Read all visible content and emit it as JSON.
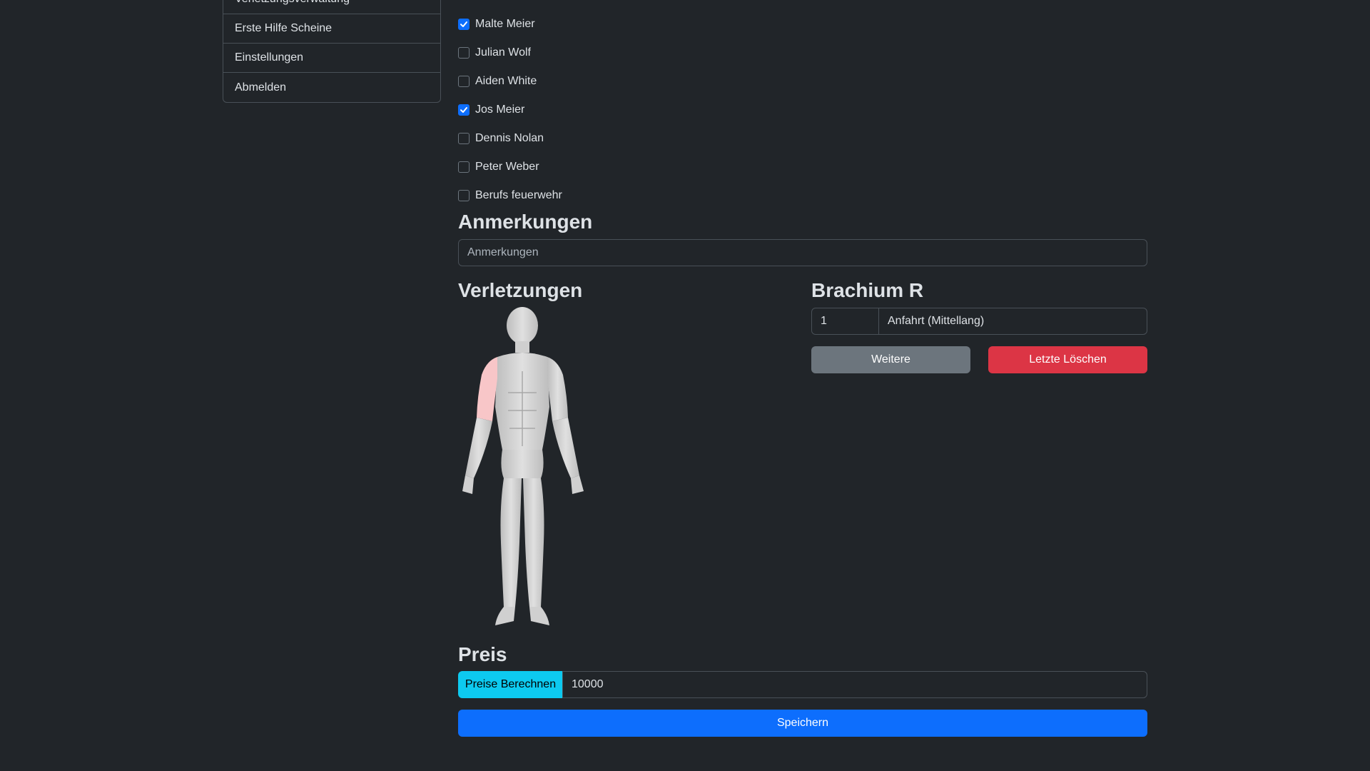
{
  "sidebar": {
    "items": [
      {
        "label": "Verletzungsverwaltung"
      },
      {
        "label": "Erste Hilfe Scheine"
      },
      {
        "label": "Einstellungen"
      },
      {
        "label": "Abmelden"
      }
    ]
  },
  "personnel": [
    {
      "name": "Malte Meier",
      "checked": true
    },
    {
      "name": "Julian Wolf",
      "checked": false
    },
    {
      "name": "Aiden White",
      "checked": false
    },
    {
      "name": "Jos Meier",
      "checked": true
    },
    {
      "name": "Dennis Nolan",
      "checked": false
    },
    {
      "name": "Peter Weber",
      "checked": false
    },
    {
      "name": "Berufs feuerwehr",
      "checked": false
    }
  ],
  "notes": {
    "heading": "Anmerkungen",
    "placeholder": "Anmerkungen"
  },
  "injuries": {
    "heading": "Verletzungen",
    "highlight_color": "#f8c6c8"
  },
  "detail": {
    "heading": "Brachium R",
    "quantity": "1",
    "item": "Anfahrt (Mittellang)",
    "more_button": "Weitere",
    "delete_button": "Letzte Löschen"
  },
  "price": {
    "heading": "Preis",
    "calc_button": "Preise Berechnen",
    "value": "10000"
  },
  "save_button": "Speichern",
  "colors": {
    "primary": "#0d6efd",
    "danger": "#dc3545",
    "secondary": "#6c757d",
    "info": "#0dcaf0",
    "background": "#212529"
  }
}
